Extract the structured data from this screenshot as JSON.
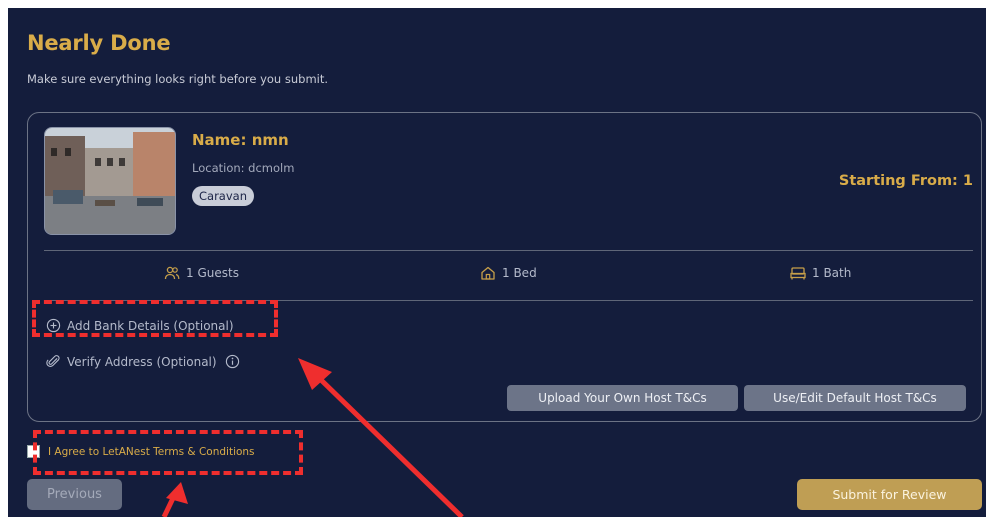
{
  "header": {
    "title": "Nearly Done",
    "subtitle": "Make sure everything looks right before you submit."
  },
  "listing": {
    "name": "Name: nmn",
    "location": "Location: dcmolm",
    "type_badge": "Caravan",
    "price": "Starting From: 1",
    "amenities": {
      "guests": "1 Guests",
      "bed": "1 Bed",
      "bath": "1 Bath"
    }
  },
  "options": {
    "bank_details": "Add Bank Details (Optional)",
    "verify_address": "Verify Address (Optional)"
  },
  "buttons": {
    "upload_tc": "Upload Your Own Host T&Cs",
    "default_tc": "Use/Edit Default Host T&Cs",
    "previous": "Previous",
    "submit": "Submit for Review"
  },
  "agreement": {
    "label": "I Agree to LetANest Terms & Conditions",
    "checked": false
  },
  "colors": {
    "panel": "#141d3c",
    "accent": "#d9ac49",
    "annotation": "#ef2e2e"
  }
}
